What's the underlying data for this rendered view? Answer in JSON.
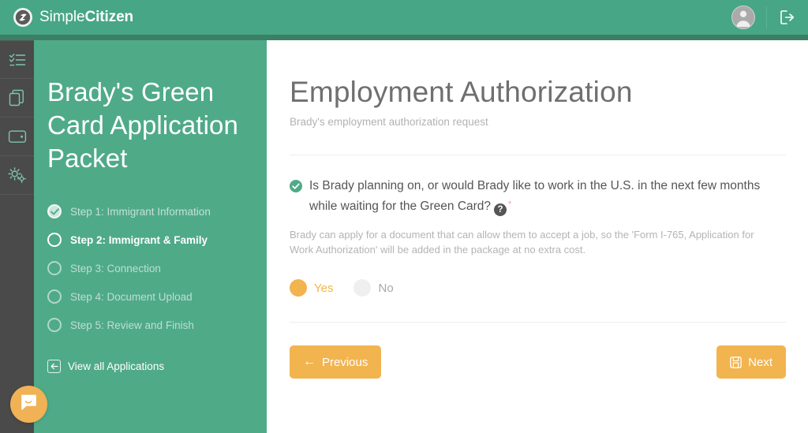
{
  "header": {
    "brand_light": "Simple",
    "brand_bold": "Citizen",
    "logo_icon": "simplecitizen-swoosh-logo",
    "avatar_icon": "user-avatar-icon",
    "logout_icon": "sign-out-icon"
  },
  "rail": {
    "items": [
      {
        "icon": "checklist-icon",
        "name": "rail-item-checklist"
      },
      {
        "icon": "documents-copy-icon",
        "name": "rail-item-documents"
      },
      {
        "icon": "wallet-icon",
        "name": "rail-item-wallet"
      },
      {
        "icon": "settings-gears-icon",
        "name": "rail-item-settings"
      }
    ]
  },
  "panel": {
    "title": "Brady's Green Card Application Packet",
    "steps": [
      {
        "label": "Step 1: Immigrant Information",
        "state": "done"
      },
      {
        "label": "Step 2: Immigrant & Family",
        "state": "active"
      },
      {
        "label": "Step 3: Connection",
        "state": "pending"
      },
      {
        "label": "Step 4: Document Upload",
        "state": "pending"
      },
      {
        "label": "Step 5: Review and Finish",
        "state": "pending"
      }
    ],
    "view_all_label": "View all Applications",
    "view_all_icon": "arrow-left-box-icon"
  },
  "chat": {
    "icon": "chat-bubble-smile-icon"
  },
  "main": {
    "title": "Employment Authorization",
    "subtitle": "Brady's employment authorization request",
    "question": {
      "status_icon": "check-circle-icon",
      "text": "Is Brady planning on, or would Brady like to work in the U.S. in the next few months while waiting for the Green Card?",
      "help_icon_label": "?",
      "required_marker": "*",
      "help_text": "Brady can apply for a document that can allow them to accept a job, so the 'Form I-765, Application for Work Authorization' will be added in the package at no extra cost.",
      "options": [
        {
          "label": "Yes",
          "selected": true
        },
        {
          "label": "No",
          "selected": false
        }
      ]
    },
    "buttons": {
      "previous_label": "Previous",
      "previous_arrow": "←",
      "next_label": "Next",
      "next_icon": "save-floppy-icon"
    }
  },
  "colors": {
    "header_green": "#47a685",
    "panel_green": "#4faa88",
    "subbar_green": "#3b7f66",
    "rail_dark": "#4a4a4a",
    "accent_amber": "#f2b44f",
    "check_green": "#4faa88",
    "required_red": "#efa1a1"
  }
}
